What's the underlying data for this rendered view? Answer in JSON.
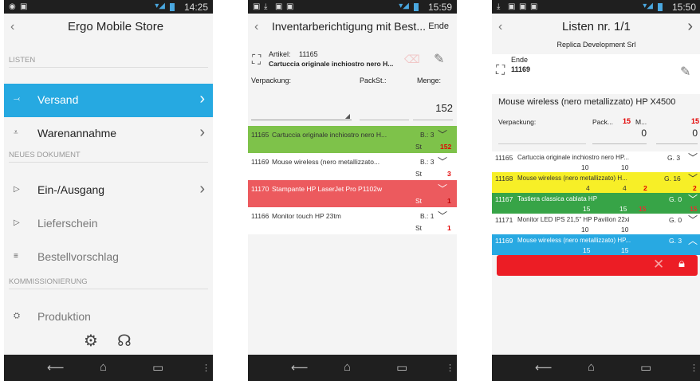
{
  "phone1": {
    "status_time": "14:25",
    "title": "Ergo Mobile Store",
    "sections": [
      {
        "label": "LISTEN",
        "items": [
          {
            "label": "Versand",
            "icon": "shipping-icon",
            "selected": true,
            "chevron": true
          },
          {
            "label": "Warenannahme",
            "icon": "receiving-icon",
            "selected": false,
            "chevron": true
          }
        ]
      },
      {
        "label": "NEUES DOKUMENT",
        "items": [
          {
            "label": "Ein-/Ausgang",
            "icon": "in-out-icon",
            "selected": false,
            "chevron": true
          },
          {
            "label": "Lieferschein",
            "icon": "delivery-note-icon",
            "selected": false,
            "chevron": false
          },
          {
            "label": "Bestellvorschlag",
            "icon": "order-proposal-icon",
            "selected": false,
            "chevron": false
          }
        ]
      },
      {
        "label": "KOMMISSIONIERUNG",
        "items": [
          {
            "label": "Produktion",
            "icon": "production-icon",
            "selected": false,
            "chevron": false
          }
        ]
      }
    ]
  },
  "phone2": {
    "status_time": "15:59",
    "title": "Inventarberichtigung mit Best...",
    "action": "Ende",
    "artikel_label": "Artikel:",
    "artikel_value": "11165",
    "artikel_desc": "Cartuccia originale inchiostro nero H...",
    "verpackung_label": "Verpackung:",
    "packst_label": "PackSt.:",
    "menge_label": "Menge:",
    "menge_value": "152",
    "rows": [
      {
        "code": "11165",
        "desc": "Cartuccia originale inchiostro nero H...",
        "b": "B.: 3",
        "st": "St",
        "qty": "152",
        "color": "green",
        "chevron": "﹀"
      },
      {
        "code": "11169",
        "desc": "Mouse wireless (nero metallizzato...",
        "b": "B.: 3",
        "st": "St",
        "qty": "3",
        "color": "white",
        "chevron": "﹀"
      },
      {
        "code": "11170",
        "desc": "Stampante HP LaserJet Pro P1102w",
        "b": "",
        "st": "St",
        "qty": "1",
        "color": "red",
        "chevron": "﹀"
      },
      {
        "code": "11166",
        "desc": "Monitor touch HP 23tm",
        "b": "B.: 1",
        "st": "St",
        "qty": "1",
        "color": "white",
        "chevron": "﹀"
      }
    ]
  },
  "phone3": {
    "status_time": "15:50",
    "title": "Listen nr. 1/1",
    "subtitle": "Replica Development Srl",
    "ende_label": "Ende",
    "ende_code": "11169",
    "product": "Mouse wireless (nero metallizzato) HP X4500",
    "verpackung_label": "Verpackung:",
    "pack_label": "Pack...",
    "pack_value": "15",
    "m_label": "M...",
    "m_value": "15",
    "field_a": "0",
    "field_b": "0",
    "rows": [
      {
        "code": "11165",
        "desc": "Cartuccia originale inchiostro nero HP...",
        "g": "G. 3",
        "n1": "10",
        "n2": "10",
        "n3": "",
        "n4": "",
        "color": "white",
        "chevron": "﹀"
      },
      {
        "code": "11168",
        "desc": "Mouse wireless (nero metallizzato) H...",
        "g": "G. 16",
        "n1": "4",
        "n2": "4",
        "n3": "2",
        "n4": "2",
        "color": "yellow",
        "chevron": "﹀"
      },
      {
        "code": "11167",
        "desc": "Tastiera classica cablata HP",
        "g": "G. 0",
        "n1": "15",
        "n2": "15",
        "n3": "15",
        "n4": "15",
        "color": "green",
        "chevron": "﹀"
      },
      {
        "code": "11171",
        "desc": "Monitor LED IPS 21,5\" HP Pavilion 22xi",
        "g": "G. 0",
        "n1": "10",
        "n2": "10",
        "n3": "",
        "n4": "",
        "color": "white",
        "chevron": "﹀"
      },
      {
        "code": "11169",
        "desc": "Mouse wireless (nero metallizzato) HP...",
        "g": "G. 3",
        "n1": "15",
        "n2": "15",
        "n3": "",
        "n4": "",
        "color": "blue",
        "chevron": "︿"
      }
    ]
  }
}
